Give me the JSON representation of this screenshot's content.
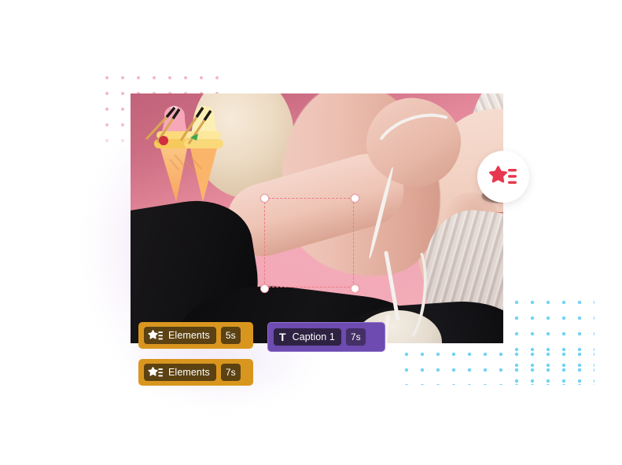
{
  "canvas": {
    "name": "video-preview",
    "selection": {
      "visible": true,
      "target": "ice-cream-sticker"
    }
  },
  "stickers": [
    {
      "id": "ice-cream-sticker",
      "name": "ice-cream-cone-sticker",
      "selected": true
    },
    {
      "id": "flower-sticker",
      "name": "flower-sticker",
      "selected": false
    }
  ],
  "elements_badge": {
    "name": "elements-badge",
    "icon": "star-list-icon",
    "color": "#e8384f"
  },
  "timeline": {
    "clips": [
      {
        "name": "clip-elements-1",
        "icon": "star-list-icon",
        "label": "Elements",
        "duration": "5s",
        "type": "elements",
        "color": "#d9961f"
      },
      {
        "name": "clip-caption",
        "icon": "text-icon",
        "icon_glyph": "T",
        "label": "Caption 1",
        "duration": "7s",
        "type": "caption",
        "color": "#6d4bb0"
      },
      {
        "name": "clip-elements-2",
        "icon": "star-list-icon",
        "label": "Elements",
        "duration": "7s",
        "type": "elements",
        "color": "#d9961f"
      }
    ]
  },
  "decor": {
    "pink_dots_color": "#f3b8c2",
    "blue_dots_color": "#74d3f5"
  }
}
